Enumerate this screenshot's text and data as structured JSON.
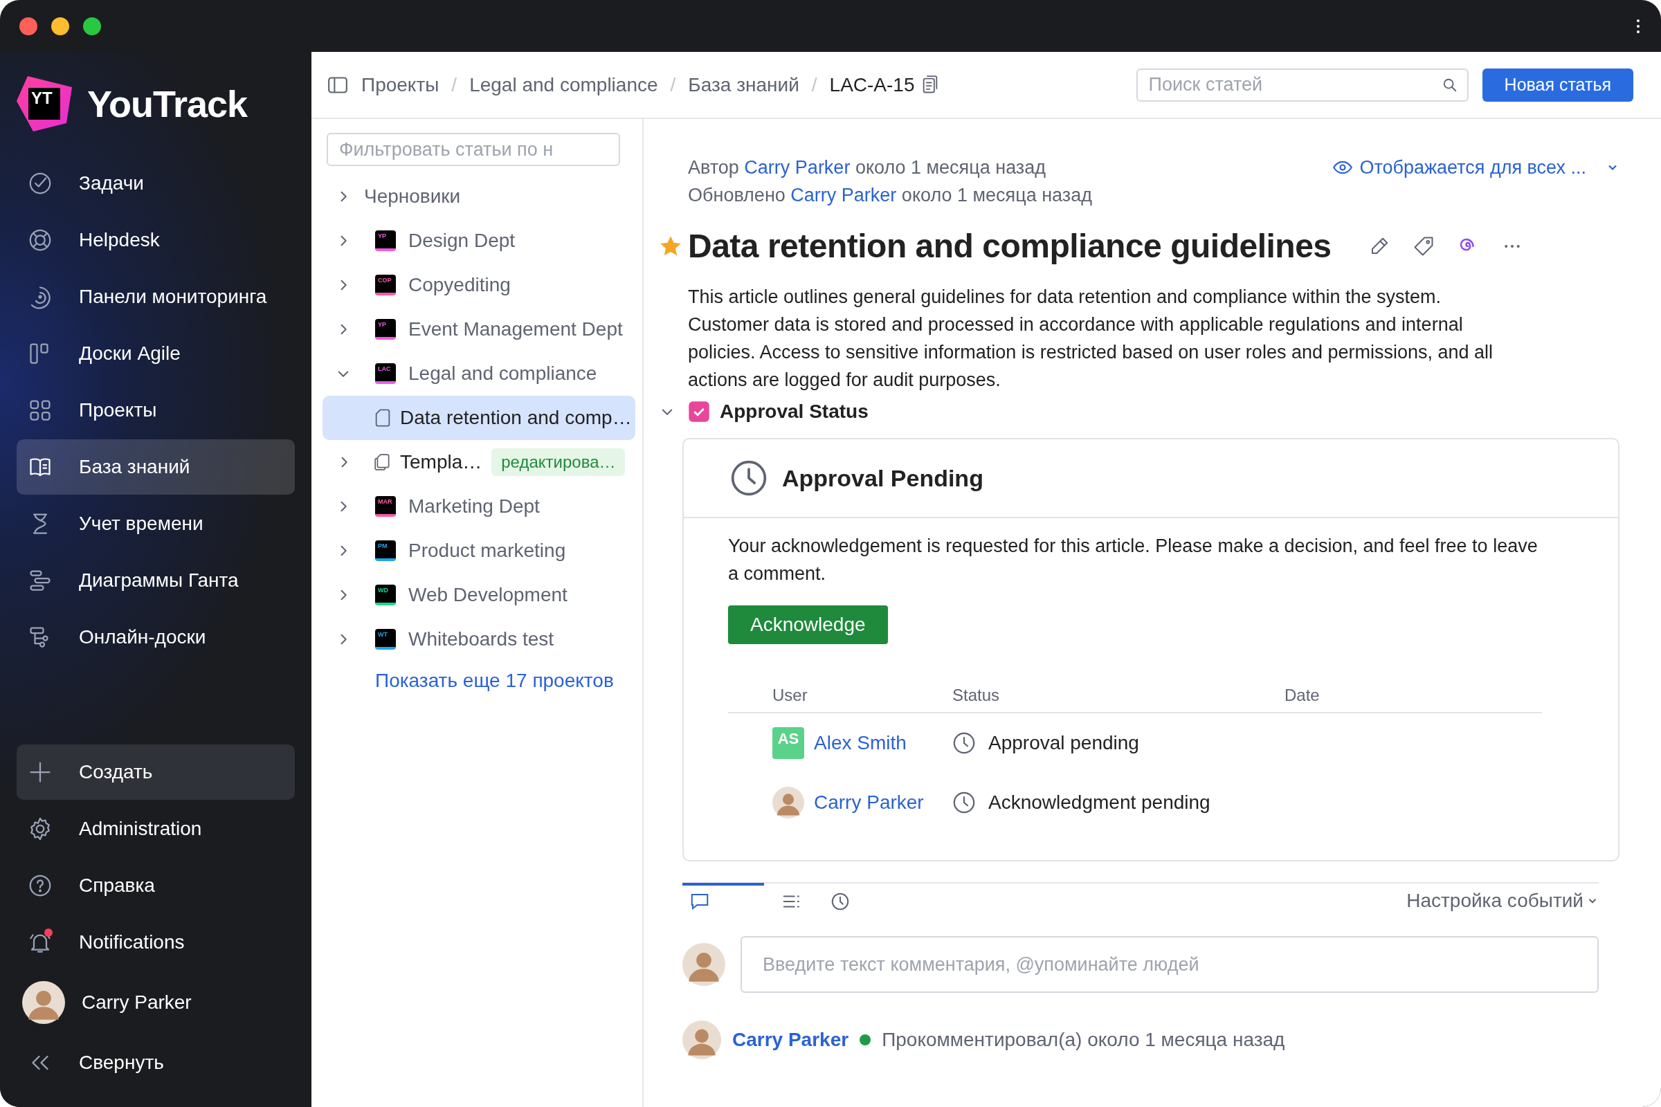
{
  "sidebar": {
    "logo": {
      "badge": "YT",
      "name": "YouTrack"
    },
    "nav": [
      {
        "kind": "tasks",
        "label": "Задачи",
        "selected": false
      },
      {
        "kind": "helpdesk",
        "label": "Helpdesk",
        "selected": false
      },
      {
        "kind": "dashboards",
        "label": "Панели мониторинга",
        "selected": false
      },
      {
        "kind": "agile",
        "label": "Доски Agile",
        "selected": false
      },
      {
        "kind": "projects",
        "label": "Проекты",
        "selected": false
      },
      {
        "kind": "knowledge",
        "label": "База знаний",
        "selected": true
      },
      {
        "kind": "time",
        "label": "Учет времени",
        "selected": false
      },
      {
        "kind": "gantt",
        "label": "Диаграммы Ганта",
        "selected": false
      },
      {
        "kind": "whiteboards",
        "label": "Онлайн-доски",
        "selected": false
      }
    ],
    "create_button": "Создать",
    "bottom": [
      {
        "kind": "admin",
        "label": "Administration"
      },
      {
        "kind": "help",
        "label": "Справка"
      },
      {
        "kind": "notifications",
        "label": "Notifications",
        "unread": true
      }
    ],
    "user": {
      "name": "Carry Parker"
    },
    "collapse": "Свернуть"
  },
  "header": {
    "separator": "/",
    "breadcrumbs": [
      "Проекты",
      "Legal and compliance",
      "База знаний",
      "LAC-A-15"
    ],
    "search": {
      "placeholder": "Поиск статей"
    },
    "new_button": "Новая статья"
  },
  "tree": {
    "filter": {
      "placeholder": "Фильтровать статьи по н"
    },
    "items": [
      {
        "kind": "folder",
        "label": "Черновики",
        "expanded": false,
        "selected": false
      },
      {
        "kind": "project",
        "badge": "YP",
        "color": "#f05ae0",
        "label": "Design Dept",
        "expanded": false,
        "selected": false
      },
      {
        "kind": "project",
        "badge": "COP",
        "color": "#ff5aa8",
        "label": "Copyediting",
        "expanded": false,
        "selected": false
      },
      {
        "kind": "project",
        "badge": "YP",
        "color": "#f05ae0",
        "label": "Event Management Dept",
        "expanded": false,
        "selected": false
      },
      {
        "kind": "project",
        "badge": "LAC",
        "color": "#e860e8",
        "label": "Legal and compliance",
        "expanded": true,
        "selected": false,
        "children": [
          {
            "kind": "article",
            "label": "Data retention and comp…",
            "selected": true
          },
          {
            "kind": "articles",
            "label": "Templa…",
            "tag": "редактирова…",
            "expanded": false,
            "selected": false
          }
        ]
      },
      {
        "kind": "project",
        "badge": "MAR",
        "color": "#ff5aa8",
        "label": "Marketing Dept",
        "expanded": false,
        "selected": false
      },
      {
        "kind": "project",
        "badge": "PM",
        "color": "#21a4f0",
        "label": "Product marketing",
        "expanded": false,
        "selected": false
      },
      {
        "kind": "project",
        "badge": "WD",
        "color": "#21d789",
        "label": "Web Development",
        "expanded": false,
        "selected": false
      },
      {
        "kind": "project",
        "badge": "WT",
        "color": "#21a4f0",
        "label": "Whiteboards test",
        "expanded": false,
        "selected": false
      }
    ],
    "more": "Показать еще 17 проектов"
  },
  "article": {
    "meta": [
      {
        "label": "Автор",
        "user": "Carry Parker",
        "time": "около 1 месяца назад"
      },
      {
        "label": "Обновлено",
        "user": "Carry Parker",
        "time": "около 1 месяца назад"
      }
    ],
    "visibility": "Отображается для всех ...",
    "title": "Data retention and compliance guidelines",
    "starred": true,
    "body": "This article outlines general guidelines for data retention and compliance within the system. Customer data is stored and processed in accordance with applicable regulations and internal policies. Access to sensitive information is restricted based on user roles and permissions, and all actions are logged for audit purposes.",
    "approval": {
      "title": "Approval Status",
      "expanded": true,
      "state": "Approval Pending",
      "message": "Your acknowledgement is requested for this article. Please make a decision, and feel free to leave a comment.",
      "button": "Acknowledge",
      "columns": [
        "User",
        "Status",
        "Date"
      ],
      "rows": [
        {
          "kind": "initials",
          "initials": "AS",
          "user": "Alex Smith",
          "status": "Approval pending"
        },
        {
          "kind": "photo",
          "user": "Carry Parker",
          "status": "Acknowledgment pending"
        }
      ]
    }
  },
  "activity": {
    "tabs": [
      {
        "kind": "comments",
        "selected": true
      },
      {
        "kind": "history",
        "selected": false
      },
      {
        "kind": "time",
        "selected": false
      }
    ],
    "settings": "Настройка событий",
    "comment_input": {
      "placeholder": "Введите текст комментария, @упоминайте людей"
    },
    "entries": [
      {
        "user": "Carry Parker",
        "online": true,
        "text": "Прокомментировал(а) около 1 месяца назад"
      }
    ]
  }
}
